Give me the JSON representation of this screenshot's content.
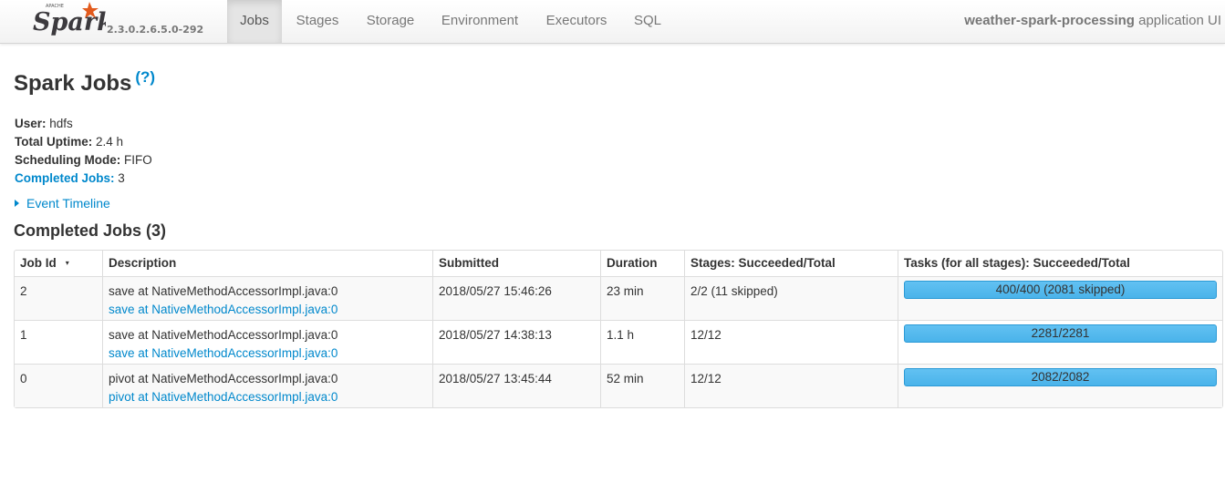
{
  "brand": {
    "logo_text": "Spark",
    "logo_small_text": "APACHE",
    "version": "2.3.0.2.6.5.0-292"
  },
  "nav": {
    "tabs": [
      {
        "label": "Jobs",
        "active": true
      },
      {
        "label": "Stages"
      },
      {
        "label": "Storage"
      },
      {
        "label": "Environment"
      },
      {
        "label": "Executors"
      },
      {
        "label": "SQL"
      }
    ],
    "app_name": "weather-spark-processing",
    "app_suffix": "application UI"
  },
  "page": {
    "title": "Spark Jobs",
    "help": "(?)"
  },
  "summary": {
    "user_label": "User:",
    "user_value": "hdfs",
    "uptime_label": "Total Uptime:",
    "uptime_value": "2.4 h",
    "mode_label": "Scheduling Mode:",
    "mode_value": "FIFO",
    "completed_label": "Completed Jobs:",
    "completed_value": "3"
  },
  "timeline": {
    "label": "Event Timeline"
  },
  "completed_section": {
    "title": "Completed Jobs (3)"
  },
  "jobs_table": {
    "headers": {
      "job_id": "Job Id",
      "sort_indicator": "▾",
      "description": "Description",
      "submitted": "Submitted",
      "duration": "Duration",
      "stages": "Stages: Succeeded/Total",
      "tasks": "Tasks (for all stages): Succeeded/Total"
    },
    "rows": [
      {
        "job_id": "2",
        "description": "save at NativeMethodAccessorImpl.java:0",
        "description_link": "save at NativeMethodAccessorImpl.java:0",
        "submitted": "2018/05/27 15:46:26",
        "duration": "23 min",
        "stages": "2/2 (11 skipped)",
        "tasks": "400/400 (2081 skipped)",
        "tasks_progress": 1.0
      },
      {
        "job_id": "1",
        "description": "save at NativeMethodAccessorImpl.java:0",
        "description_link": "save at NativeMethodAccessorImpl.java:0",
        "submitted": "2018/05/27 14:38:13",
        "duration": "1.1 h",
        "stages": "12/12",
        "tasks": "2281/2281",
        "tasks_progress": 1.0
      },
      {
        "job_id": "0",
        "description": "pivot at NativeMethodAccessorImpl.java:0",
        "description_link": "pivot at NativeMethodAccessorImpl.java:0",
        "submitted": "2018/05/27 13:45:44",
        "duration": "52 min",
        "stages": "12/12",
        "tasks": "2082/2082",
        "tasks_progress": 1.0
      }
    ]
  },
  "colors": {
    "link": "#0088cc",
    "progress": "#5bbcf0",
    "text": "#333333",
    "nav_text": "#777777"
  }
}
